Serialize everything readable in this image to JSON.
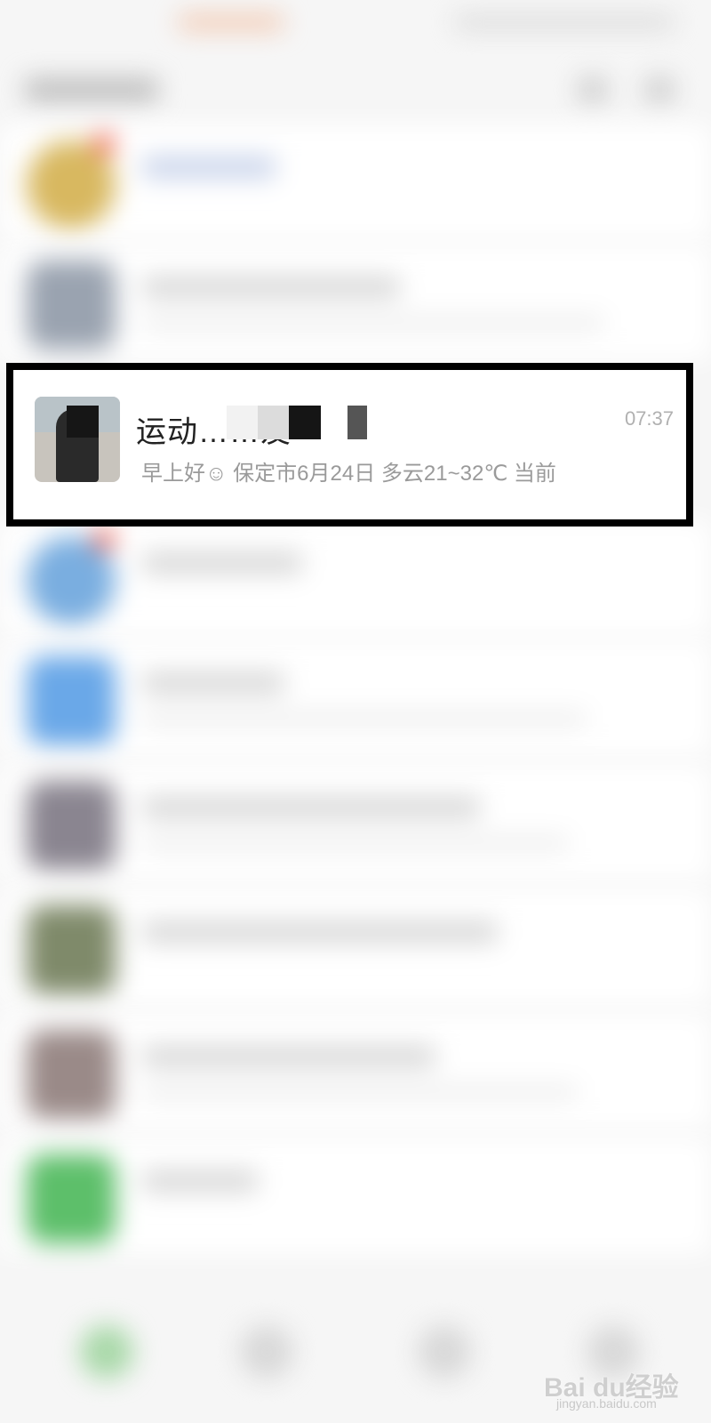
{
  "highlighted_chat": {
    "name": "运动……友",
    "time": "07:37",
    "preview": "早上好☺ 保定市6月24日 多云21~32℃ 当前"
  },
  "watermark": {
    "brand": "Bai du经验",
    "url": "jingyan.baidu.com"
  },
  "colors": {
    "frame": "#000000",
    "background": "#f6f6f6",
    "time": "#b0b0b0"
  }
}
